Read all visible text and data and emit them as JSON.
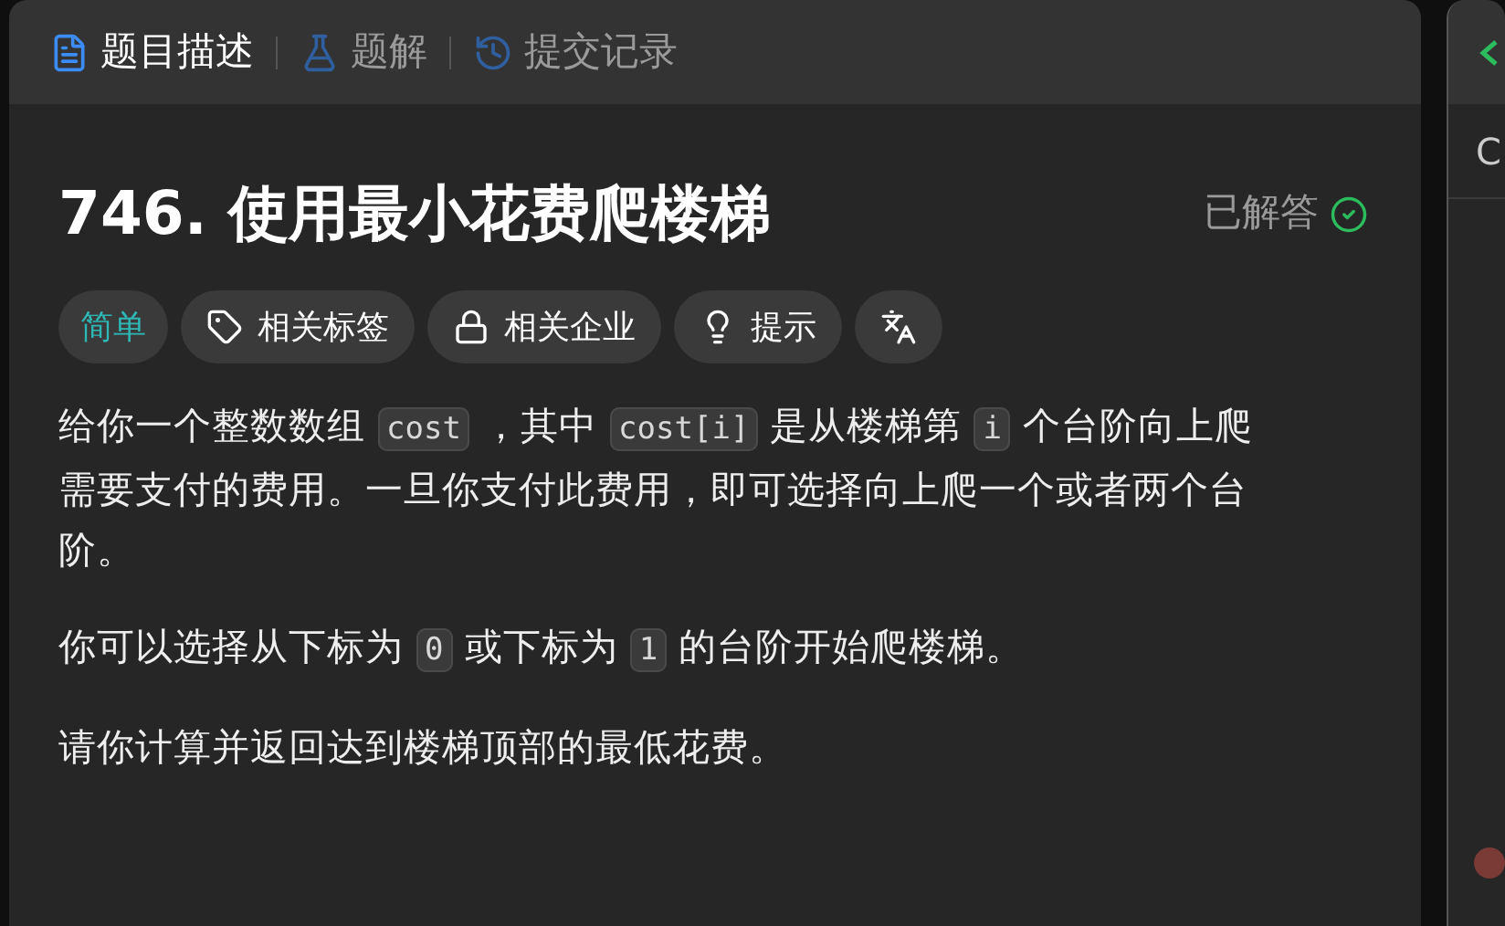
{
  "tabs": [
    {
      "label": "题目描述",
      "kind": "document",
      "selected": true
    },
    {
      "label": "题解",
      "kind": "flask",
      "selected": false
    },
    {
      "label": "提交记录",
      "kind": "history",
      "selected": false
    }
  ],
  "problem": {
    "title": "746. 使用最小花费爬楼梯",
    "status": "已解答",
    "solved": true
  },
  "tags": [
    {
      "kind": "difficulty",
      "label": "简单",
      "color": "#2db7b5"
    },
    {
      "kind": "tag",
      "label": "相关标签"
    },
    {
      "kind": "lock",
      "label": "相关企业"
    },
    {
      "kind": "hint",
      "label": "提示"
    },
    {
      "kind": "translate"
    }
  ],
  "description": [
    [
      {
        "kind": "text",
        "text": "给你一个整数数组 "
      },
      {
        "kind": "code",
        "text": "cost"
      },
      {
        "kind": "text",
        "text": " ，其中 "
      },
      {
        "kind": "code",
        "text": "cost[i]"
      },
      {
        "kind": "text",
        "text": " 是从楼梯第 "
      },
      {
        "kind": "code",
        "text": "i"
      },
      {
        "kind": "text",
        "text": " 个台阶向上爬需要支付的费用。一旦你支付此费用，即可选择向上爬一个或者两个台阶。"
      }
    ],
    [
      {
        "kind": "text",
        "text": "你可以选择从下标为 "
      },
      {
        "kind": "code",
        "text": "0"
      },
      {
        "kind": "text",
        "text": " 或下标为 "
      },
      {
        "kind": "code",
        "text": "1"
      },
      {
        "kind": "text",
        "text": " 的台阶开始爬楼梯。"
      }
    ],
    [
      {
        "kind": "text",
        "text": "请你计算并返回达到楼梯顶部的最低花费。"
      }
    ]
  ],
  "editor_panel": {
    "tab_text": "C"
  }
}
